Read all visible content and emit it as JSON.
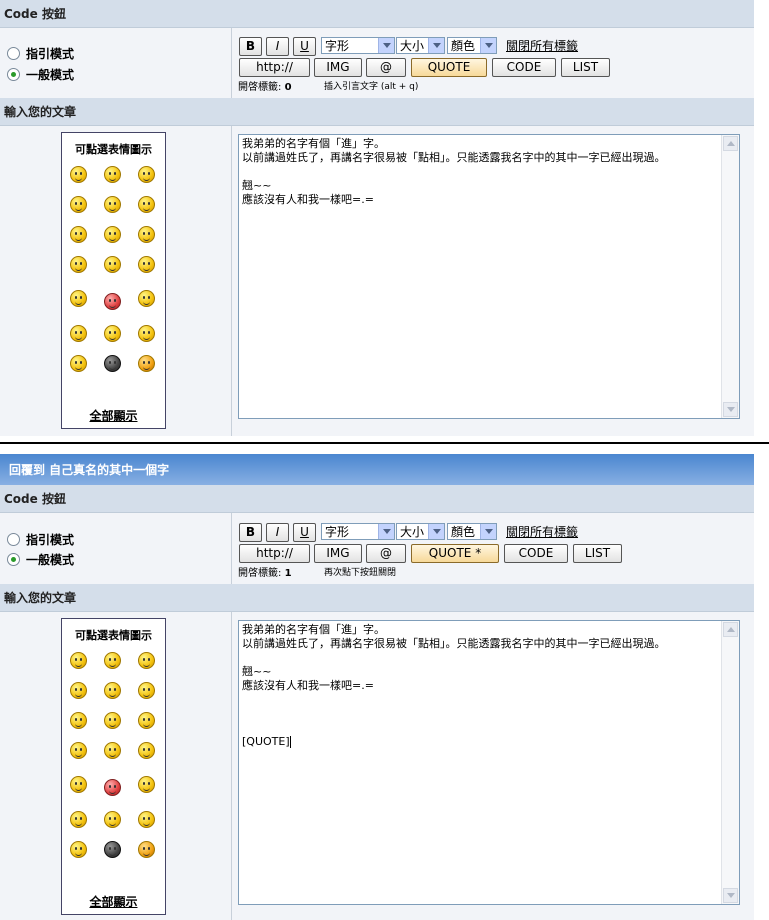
{
  "code_section": "Code 按鈕",
  "reply_title": "回覆到 自己真名的其中一個字",
  "mode_guided": "指引模式",
  "mode_normal": "一般模式",
  "toolbar": {
    "bold": "B",
    "italic": "I",
    "underline": "U",
    "font_select": "字形",
    "size_select": "大小",
    "color_select": "顏色",
    "close_all": "關閉所有標籤",
    "url": "http://",
    "img": "IMG",
    "email": "@",
    "quote": "QUOTE",
    "quote_open": "QUOTE *",
    "code": "CODE",
    "list": "LIST"
  },
  "open_tags_label": "開啓標籤:",
  "panel1": {
    "open_tags_count": "0",
    "hint": "插入引言文字 (alt + q)"
  },
  "panel2": {
    "open_tags_count": "1",
    "hint": "再次點下按鈕關閉"
  },
  "post_section": "輸入您的文章",
  "smilies_title": "可點選表情圖示",
  "show_all": "全部顯示",
  "message_lines": {
    "l1": "我弟弟的名字有個「進」字。",
    "l2": "以前講過姓氏了，再講名字很易被「點相」。只能透露我名字中的其中一字已經出現過。",
    "l3": "翹~~",
    "l4": "應該沒有人和我一樣吧=.="
  },
  "quote_tag": "[QUOTE]"
}
